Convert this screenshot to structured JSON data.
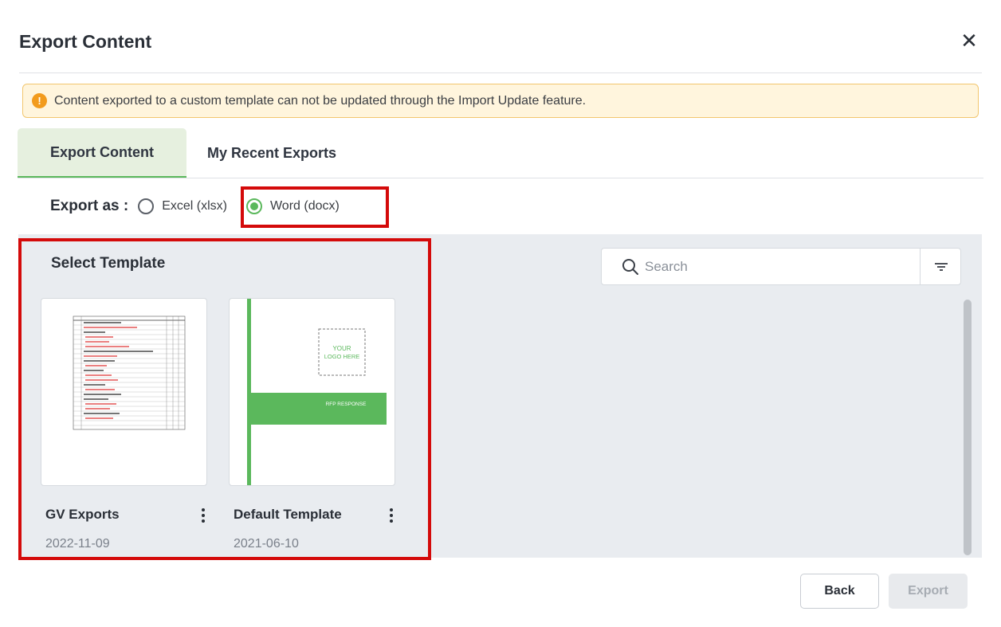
{
  "dialog": {
    "title": "Export Content",
    "close_symbol": "✕"
  },
  "warning": {
    "icon": "info-icon",
    "icon_symbol": "!",
    "text": "Content exported to a custom template can not be updated through the Import Update feature."
  },
  "tabs": [
    {
      "label": "Export Content",
      "active": true
    },
    {
      "label": "My Recent Exports",
      "active": false
    }
  ],
  "export_as": {
    "label": "Export as :",
    "options": [
      {
        "label": "Excel (xlsx)",
        "checked": false
      },
      {
        "label": "Word (docx)",
        "checked": true
      }
    ]
  },
  "templates": {
    "heading": "Select Template",
    "items": [
      {
        "name": "GV Exports",
        "date": "2022-11-09",
        "thumbnail": "document-table-thumbnail"
      },
      {
        "name": "Default Template",
        "date": "2021-06-10",
        "thumbnail": "rfp-cover-thumbnail",
        "logo_text_1": "YOUR",
        "logo_text_2": "LOGO HERE",
        "banner_text": "RFP RESPONSE"
      }
    ]
  },
  "search": {
    "placeholder": "Search",
    "value": ""
  },
  "buttons": {
    "back": "Back",
    "export": "Export"
  },
  "colors": {
    "accent_green": "#5bb85c",
    "highlight_red": "#d40a0a",
    "warning_bg": "#fff5dd",
    "warning_icon": "#f29b1d",
    "panel_bg": "#e9ecf0"
  }
}
